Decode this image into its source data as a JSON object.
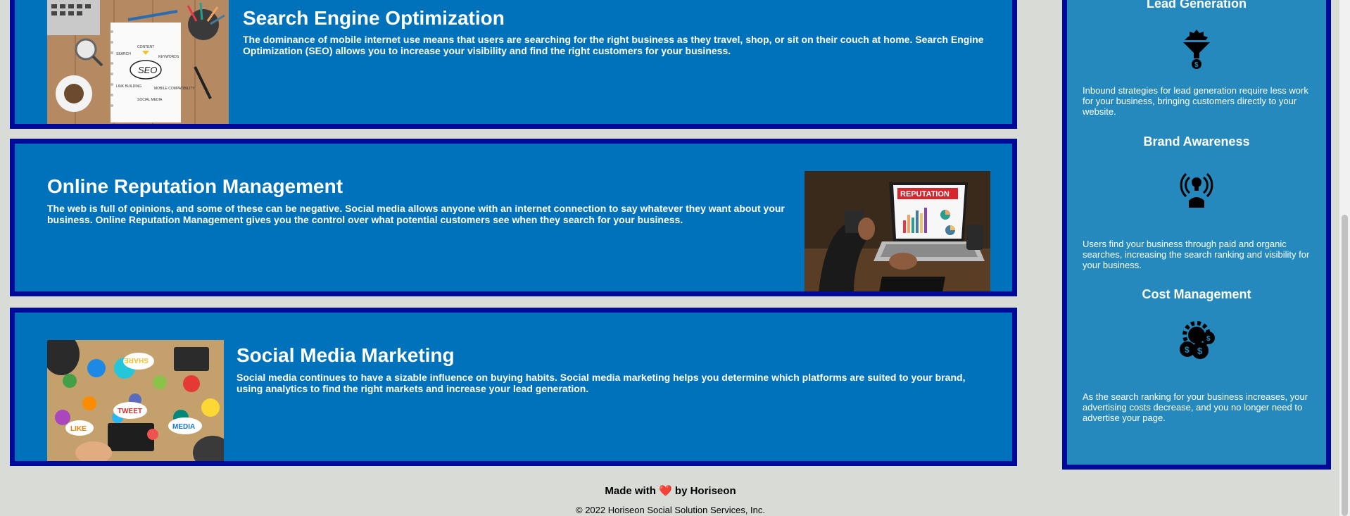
{
  "content": {
    "seo": {
      "title": "Search Engine Optimization",
      "text": "The dominance of mobile internet use means that users are searching for the right business as they travel, shop, or sit on their couch at home. Search Engine Optimization (SEO) allows you to increase your visibility and find the right customers for your business.",
      "image_words": [
        "SEO",
        "CONTENT",
        "KEYWORDS",
        "SEARCH",
        "LINK BUILDING",
        "MOBILE COMPATIBILITY",
        "SOCIAL MEDIA"
      ]
    },
    "reputation": {
      "title": "Online Reputation Management",
      "text": "The web is full of opinions, and some of these can be negative. Social media allows anyone with an internet connection to say whatever they want about your business. Online Reputation Management gives you the control over what potential customers see when they search for your business.",
      "image_word": "REPUTATION"
    },
    "social": {
      "title": "Social Media Marketing",
      "text": "Social media continues to have a sizable influence on buying habits. Social media marketing helps you determine which platforms are suited to your brand, using analytics to find the right markets and increase your lead generation.",
      "image_words": [
        "SHARE",
        "TWEET",
        "LIKE",
        "MEDIA"
      ]
    }
  },
  "benefits": {
    "lead": {
      "title": "Lead Generation",
      "icon": "lead-funnel-icon",
      "text": "Inbound strategies for lead generation require less work for your business, bringing customers directly to your website."
    },
    "brand": {
      "title": "Brand Awareness",
      "icon": "brand-lightbulb-icon",
      "text": "Users find your business through paid and organic searches, increasing the search ranking and visibility for your business."
    },
    "cost": {
      "title": "Cost Management",
      "icon": "cost-gear-coins-icon",
      "text": "As the search ranking for your business increases, your advertising costs decrease, and you no longer need to advertise your page."
    }
  },
  "footer": {
    "made_before": "Made with",
    "heart": "❤️",
    "made_after": "by Horiseon",
    "copyright": "© 2022 Horiseon Social Solution Services, Inc."
  },
  "colors": {
    "page_bg": "#d9dcd6",
    "card_bg": "#0072bb",
    "card_border": "#000a9a",
    "sidebar_bg": "#2589bd"
  }
}
